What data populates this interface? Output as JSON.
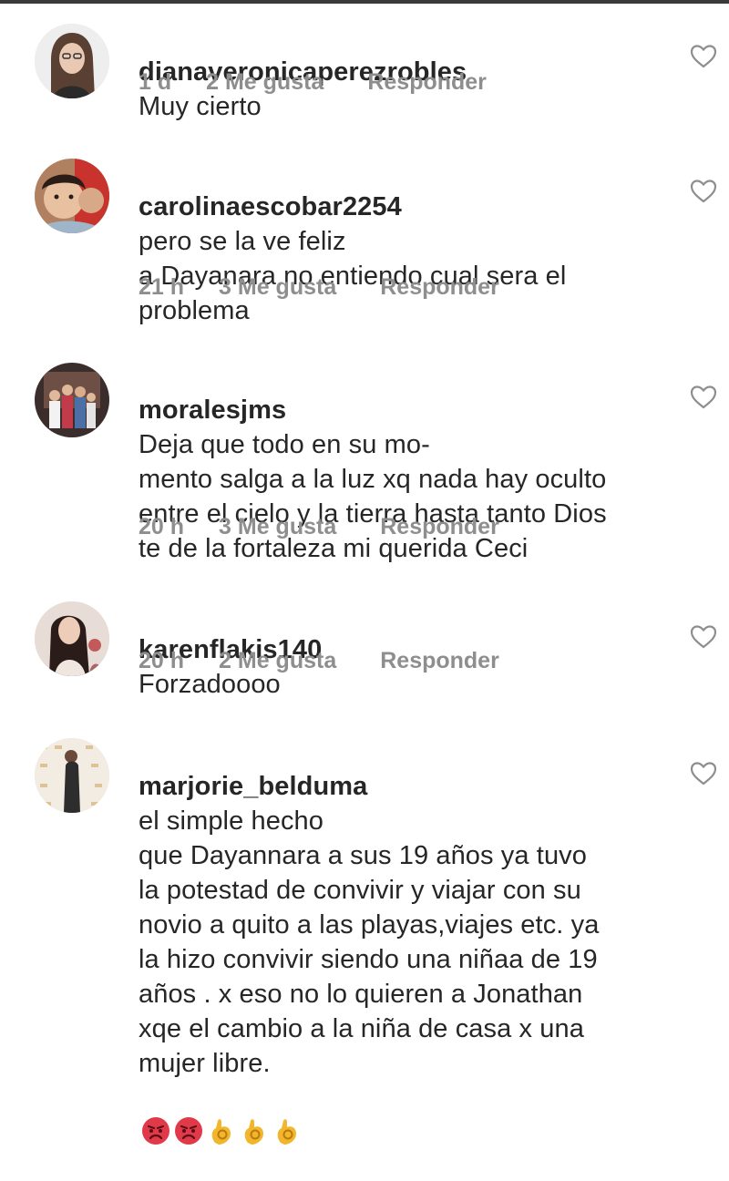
{
  "comments": [
    {
      "username": "dianaveronicaperezrobles",
      "text": "Muy cierto",
      "time": "1 d",
      "likes": "2 Me gusta",
      "reply": "Responder",
      "avatar_icon": "avatar-woman-long-hair"
    },
    {
      "username": "carolinaescobar2254",
      "text": "pero se la ve feliz\na Dayanara no entiendo cual sera el\nproblema",
      "time": "21 h",
      "likes": "3 Me gusta",
      "reply": "Responder",
      "avatar_icon": "avatar-child-photo"
    },
    {
      "username": "moralesjms",
      "text": "Deja que todo en su mo-\nmento salga a la luz xq nada hay oculto\nentre el cielo y la tierra hasta tanto Dios\nte de la fortaleza mi querida Ceci",
      "time": "20 h",
      "likes": "3 Me gusta",
      "reply": "Responder",
      "avatar_icon": "avatar-group-photo"
    },
    {
      "username": "karenflakis140",
      "text": "Forzadoooo",
      "time": "20 h",
      "likes": "2 Me gusta",
      "reply": "Responder",
      "avatar_icon": "avatar-woman-photo"
    },
    {
      "username": "marjorie_belduma",
      "text": "el simple hecho\nque Dayannara a sus 19 años ya tuvo\nla potestad de convivir y viajar con su\nnovio a quito a las playas,viajes etc. ya\nla hizo convivir siendo una niñaa de 19\naños . x eso no lo quieren a Jonathan\nxqe el cambio a la niña de casa x una\nmujer libre.",
      "emojis": [
        "angry-face-emoji",
        "angry-face-emoji",
        "ok-hand-emoji",
        "ok-hand-emoji",
        "ok-hand-emoji"
      ],
      "avatar_icon": "avatar-event-backdrop-photo"
    }
  ],
  "colors": {
    "text": "#262626",
    "meta": "#8e8e8e",
    "heart_outline": "#8e8e8e"
  }
}
